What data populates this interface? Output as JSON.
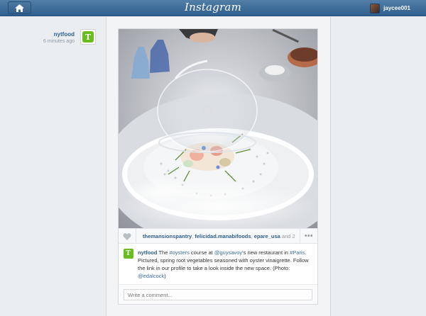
{
  "header": {
    "app_title": "Instagram",
    "home_icon": "home-icon",
    "username": "jaycee001"
  },
  "post": {
    "author": "nytfood",
    "time_ago": "6 minutes ago",
    "likes": {
      "users": [
        "themansionspantry",
        "felicidad.manabifoods",
        "epare_usa"
      ],
      "separator": ", ",
      "more": " and 2..."
    },
    "more_label": "•••",
    "caption": {
      "author": "nytfood",
      "parts": [
        {
          "text": " The ",
          "type": "text"
        },
        {
          "text": "#oysters",
          "type": "link"
        },
        {
          "text": " course at ",
          "type": "text"
        },
        {
          "text": "@guysavoy",
          "type": "link"
        },
        {
          "text": "'s new restaurant in ",
          "type": "text"
        },
        {
          "text": "#Paris",
          "type": "link"
        },
        {
          "text": ". Pictured, spring root vegetables seasoned with oyster vinaigrette. Follow the link in our profile to take a look inside the new space. (Photo: ",
          "type": "text"
        },
        {
          "text": "@edalcock",
          "type": "link"
        },
        {
          "text": ")",
          "type": "text"
        }
      ]
    },
    "comment_placeholder": "Write a comment..."
  },
  "colors": {
    "brand_blue": "#2f5f8d",
    "link_blue": "#3d6da0",
    "nyt_green": "#6abd1e"
  }
}
